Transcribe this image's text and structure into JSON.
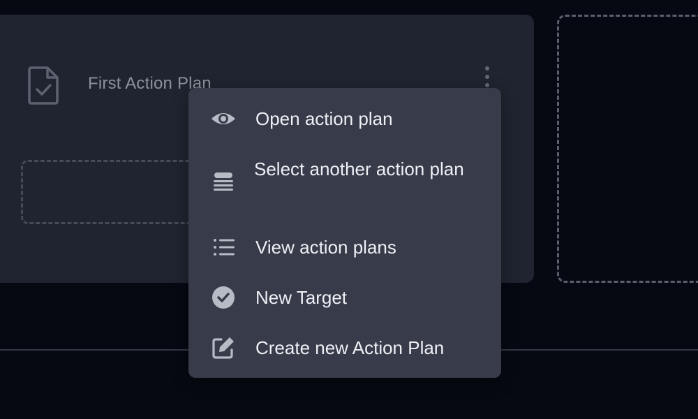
{
  "card": {
    "title": "First Action Plan",
    "icon": "document-check-icon",
    "more_icon": "kebab-vertical-icon"
  },
  "menu": {
    "items": [
      {
        "label": "Open action plan",
        "icon": "eye-icon"
      },
      {
        "label": "Select another action plan",
        "icon": "stack-icon"
      },
      {
        "label": "View action plans",
        "icon": "list-icon"
      },
      {
        "label": "New Target",
        "icon": "check-circle-icon"
      },
      {
        "label": "Create new Action Plan",
        "icon": "edit-icon"
      }
    ]
  },
  "colors": {
    "background": "#060912",
    "card": "#1f2430",
    "menu": "#373b4a",
    "menu_text": "#eef0f4",
    "muted_text": "#8c919b"
  }
}
